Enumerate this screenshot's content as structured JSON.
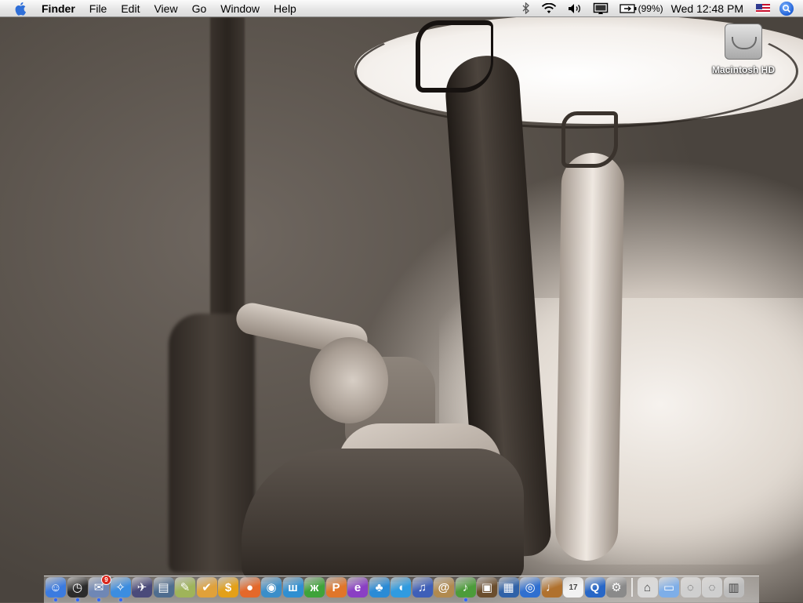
{
  "menubar": {
    "app_name": "Finder",
    "menus": [
      "File",
      "Edit",
      "View",
      "Go",
      "Window",
      "Help"
    ],
    "status": {
      "battery_percent": "(99%)",
      "clock": "Wed 12:48 PM"
    }
  },
  "desktop": {
    "icons": [
      {
        "label": "Macintosh HD",
        "icon": "hard-drive-icon"
      }
    ]
  },
  "dock": {
    "apps": [
      {
        "name": "finder",
        "icon": "finder-icon",
        "color": "#3b7be0",
        "glyph": "☺",
        "running": true
      },
      {
        "name": "dashboard",
        "icon": "dashboard-icon",
        "color": "#2b2b2b",
        "glyph": "◷",
        "running": true
      },
      {
        "name": "mail",
        "icon": "mail-icon",
        "color": "#6f87b5",
        "glyph": "✉",
        "running": true,
        "badge": "9"
      },
      {
        "name": "safari",
        "icon": "safari-icon",
        "color": "#3b8de0",
        "glyph": "✧",
        "running": true
      },
      {
        "name": "app-5",
        "icon": "rocket-icon",
        "color": "#4a4a7a",
        "glyph": "✈",
        "running": false
      },
      {
        "name": "app-6",
        "icon": "preview-icon",
        "color": "#4f6d8f",
        "glyph": "▤",
        "running": false
      },
      {
        "name": "app-7",
        "icon": "pencil-icon",
        "color": "#9fb45a",
        "glyph": "✎",
        "running": false
      },
      {
        "name": "app-8",
        "icon": "checklist-icon",
        "color": "#e0a13a",
        "glyph": "✔",
        "running": false
      },
      {
        "name": "app-9",
        "icon": "dollar-icon",
        "color": "#e3a018",
        "glyph": "$",
        "running": false
      },
      {
        "name": "firefox",
        "icon": "firefox-icon",
        "color": "#e4682a",
        "glyph": "●",
        "running": false
      },
      {
        "name": "app-11",
        "icon": "globe-icon",
        "color": "#3a8ec9",
        "glyph": "◉",
        "running": false
      },
      {
        "name": "app-12",
        "icon": "letter-w-icon",
        "color": "#2f8fd1",
        "glyph": "ш",
        "running": false
      },
      {
        "name": "app-13",
        "icon": "letter-x-icon",
        "color": "#3fa33a",
        "glyph": "ж",
        "running": false
      },
      {
        "name": "app-14",
        "icon": "letter-p-icon",
        "color": "#e0762a",
        "glyph": "Р",
        "running": false
      },
      {
        "name": "app-15",
        "icon": "letter-e-icon",
        "color": "#8a3fc4",
        "glyph": "е",
        "running": false
      },
      {
        "name": "app-16",
        "icon": "buddy-icon",
        "color": "#2a8bd6",
        "glyph": "♣",
        "running": false
      },
      {
        "name": "app-17",
        "icon": "video-chat-icon",
        "color": "#2f9be0",
        "glyph": "◖",
        "running": false
      },
      {
        "name": "app-18",
        "icon": "itunes-runner-icon",
        "color": "#3e5fb8",
        "glyph": "♫",
        "running": false
      },
      {
        "name": "app-19",
        "icon": "address-book-icon",
        "color": "#b18a4f",
        "glyph": "@",
        "running": false
      },
      {
        "name": "itunes",
        "icon": "itunes-icon",
        "color": "#4c9c3a",
        "glyph": "♪",
        "running": true
      },
      {
        "name": "app-21",
        "icon": "iphoto-icon",
        "color": "#6b4e2e",
        "glyph": "▣",
        "running": false
      },
      {
        "name": "app-22",
        "icon": "imovie-icon",
        "color": "#3062a8",
        "glyph": "▦",
        "running": false
      },
      {
        "name": "app-23",
        "icon": "idvd-icon",
        "color": "#2f6fd0",
        "glyph": "◎",
        "running": false
      },
      {
        "name": "app-24",
        "icon": "garageband-icon",
        "color": "#b0712e",
        "glyph": "♩",
        "running": false
      },
      {
        "name": "app-25",
        "icon": "ical-icon",
        "color": "#f2f2f2",
        "glyph": "17",
        "running": false
      },
      {
        "name": "app-26",
        "icon": "quicktime-icon",
        "color": "#2867c7",
        "glyph": "Q",
        "running": false
      },
      {
        "name": "app-27",
        "icon": "system-prefs-icon",
        "color": "#8a8a8a",
        "glyph": "⚙",
        "running": false
      }
    ],
    "docs": [
      {
        "name": "home",
        "icon": "home-folder-icon",
        "color": "#d9d9d9",
        "glyph": "⌂"
      },
      {
        "name": "documents",
        "icon": "folder-icon",
        "color": "#7eaee8",
        "glyph": "▭"
      },
      {
        "name": "stack-1",
        "icon": "stack-icon",
        "color": "#cfcfcf",
        "glyph": "◌"
      },
      {
        "name": "stack-2",
        "icon": "stack-icon",
        "color": "#cfcfcf",
        "glyph": "◌"
      },
      {
        "name": "trash",
        "icon": "trash-icon",
        "color": "#bcbcbc",
        "glyph": "▥"
      }
    ]
  }
}
